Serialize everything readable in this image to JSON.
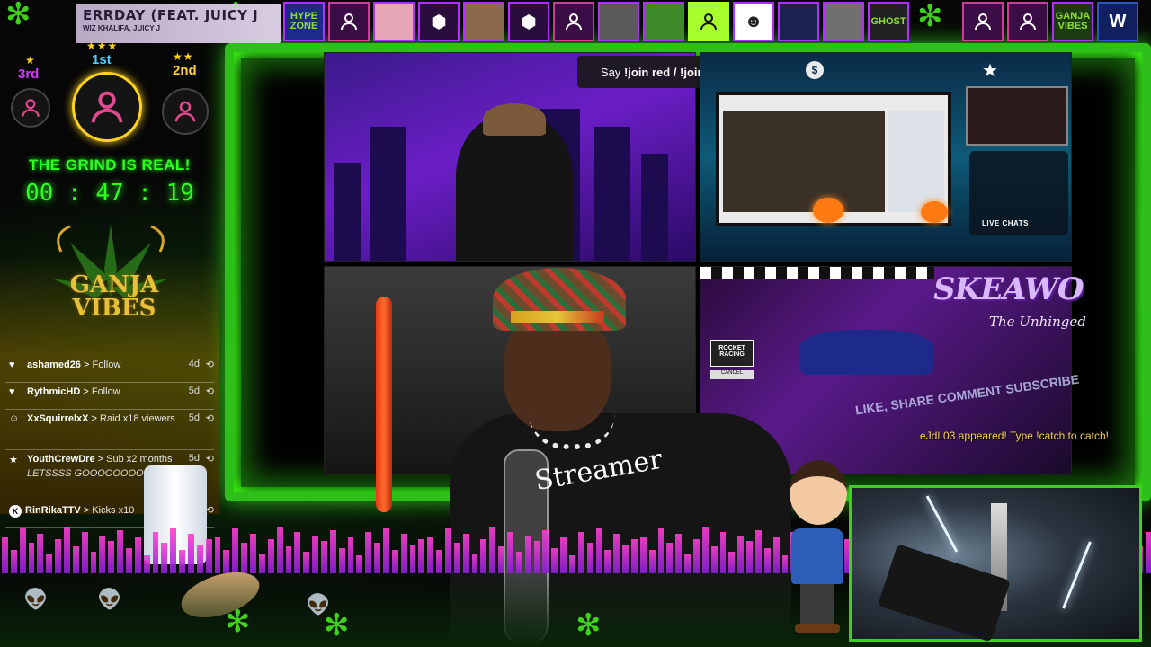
{
  "now_playing": {
    "title": "ERRDAY (FEAT. JUICY J",
    "artist": "WIZ KHALIFA, JUICY J"
  },
  "top_avatars": [
    {
      "name": "hypezone-tile",
      "kind": "tile",
      "text": "HYPE ZONE",
      "color": "#1e2a8a"
    },
    {
      "name": "default-user",
      "kind": "default"
    },
    {
      "name": "anime-girl",
      "kind": "photo",
      "color": "#e7a6b8"
    },
    {
      "name": "white-dice",
      "kind": "dice"
    },
    {
      "name": "anime-boy",
      "kind": "photo",
      "color": "#8a6a4a"
    },
    {
      "name": "white-dice",
      "kind": "dice"
    },
    {
      "name": "default-user",
      "kind": "default"
    },
    {
      "name": "wolf-warrior",
      "kind": "photo",
      "color": "#5a5a5a"
    },
    {
      "name": "green-monster",
      "kind": "photo",
      "color": "#3c8a2a"
    },
    {
      "name": "lime-user",
      "kind": "lime"
    },
    {
      "name": "mask-face",
      "kind": "white"
    },
    {
      "name": "rocket-logo",
      "kind": "photo",
      "color": "#1a2350"
    },
    {
      "name": "bw-photo",
      "kind": "photo",
      "color": "#707070"
    },
    {
      "name": "ghost-tile",
      "kind": "tile",
      "text": "GHOST",
      "color": "#222"
    }
  ],
  "top_avatars_right": [
    {
      "name": "default-user",
      "kind": "default"
    },
    {
      "name": "default-user",
      "kind": "default"
    },
    {
      "name": "ganja-vibes-logo",
      "kind": "tile",
      "text": "GANJA VIBES",
      "color": "#1a3a10"
    },
    {
      "name": "w-logo",
      "kind": "navy",
      "text": "W"
    }
  ],
  "leaderboard": {
    "third": "3rd",
    "first": "1st",
    "second": "2nd"
  },
  "grind_banner": "THE GRIND IS REAL!",
  "timer": {
    "h": "00",
    "m": "47",
    "s": "19"
  },
  "logo_text": "GANJA VIBES",
  "feed": [
    {
      "icon": "heart-icon",
      "glyph": "♥",
      "user": "ashamed26",
      "action": "Follow",
      "age": "4d"
    },
    {
      "icon": "heart-icon",
      "glyph": "♥",
      "user": "RythmicHD",
      "action": "Follow",
      "age": "5d"
    },
    {
      "icon": "raid-icon",
      "glyph": "☺",
      "user": "XxSquirrelxX",
      "action": "Raid x18 viewers",
      "age": "5d"
    },
    {
      "icon": "star-icon",
      "glyph": "★",
      "user": "YouthCrewDre",
      "action": "Sub x2 months",
      "note": "LETSSSS GOOOOOOOOO",
      "age": "5d"
    },
    {
      "icon": "kick-icon",
      "glyph": "K",
      "user": "RinRikaTTV",
      "action": "Kicks x10",
      "age": "5d"
    }
  ],
  "join_banner": {
    "prefix": "Say ",
    "command": "!join red / !join blue / !join"
  },
  "live_chats_label": "LIVE CHATS",
  "rocket_racing": "ROCKET RACING",
  "rocket_cancel": "CANCEL",
  "skeawo": {
    "title": "SKEAWO",
    "subtitle": "The Unhinged"
  },
  "like_share": "LIKE, SHARE COMMENT SUBSCRIBE",
  "catch_message": "eJdL03 appeared! Type !catch to catch!",
  "shirt_text": "Streamer",
  "colors": {
    "accent_green": "#2cff1f",
    "frame_green": "#2fbf1a",
    "gold": "#ffd21f",
    "magenta": "#d13aff"
  }
}
